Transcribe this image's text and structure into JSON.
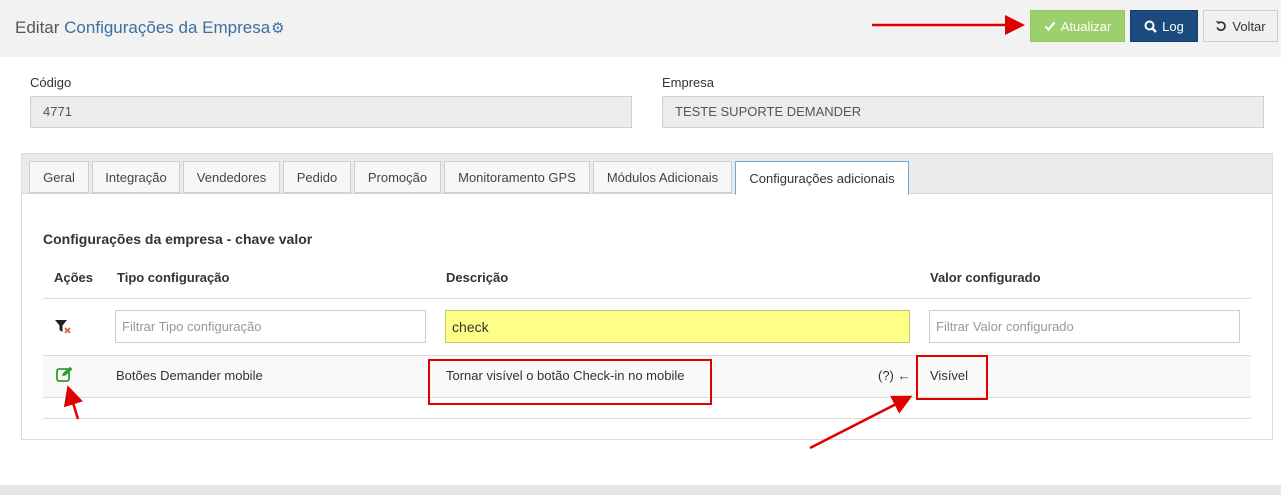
{
  "header": {
    "title_prefix": "Editar",
    "title_main": "Configurações da Empresa",
    "buttons": {
      "update": "Atualizar",
      "log": "Log",
      "back": "Voltar"
    }
  },
  "form": {
    "code_label": "Código",
    "code_value": "4771",
    "company_label": "Empresa",
    "company_value": "TESTE SUPORTE DEMANDER"
  },
  "tabs": [
    {
      "label": "Geral"
    },
    {
      "label": "Integração"
    },
    {
      "label": "Vendedores"
    },
    {
      "label": "Pedido"
    },
    {
      "label": "Promoção"
    },
    {
      "label": "Monitoramento GPS"
    },
    {
      "label": "Módulos Adicionais"
    },
    {
      "label": "Configurações adicionais",
      "active": true
    }
  ],
  "section": {
    "title": "Configurações da empresa - chave valor"
  },
  "table": {
    "headers": {
      "actions": "Ações",
      "type": "Tipo configuração",
      "description": "Descrição",
      "value": "Valor configurado"
    },
    "filters": {
      "type_placeholder": "Filtrar Tipo configuração",
      "description_value": "check",
      "value_placeholder": "Filtrar Valor configurado"
    },
    "rows": [
      {
        "type": "Botões Demander mobile",
        "description": "Tornar visível o botão Check-in no mobile",
        "help": "(?) ←",
        "value": "Visível"
      }
    ]
  },
  "colors": {
    "accent": "#3c6f9f",
    "update_button": "#9dd06c",
    "log_button": "#1b4b7c",
    "annotation_red": "#e00000",
    "filter_highlight": "#ffff88",
    "edit_icon": "#2f9e2f"
  },
  "icons": {
    "update": "check-icon",
    "log": "search-icon",
    "back": "undo-icon",
    "title": "gears-icon",
    "filter_clear": "filter-clear-icon",
    "row_edit": "edit-icon"
  }
}
